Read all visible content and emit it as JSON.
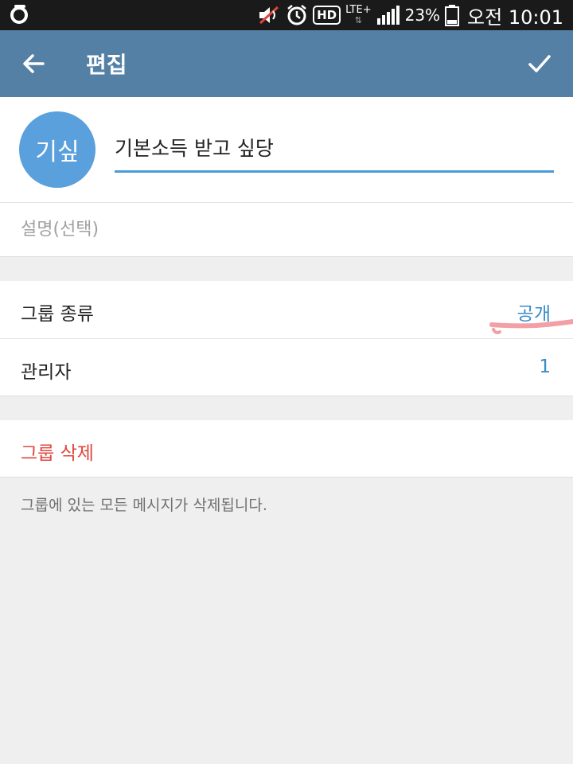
{
  "status_bar": {
    "battery": "23%",
    "time": "오전 10:01",
    "hd_label": "HD",
    "lte_label": "LTE+",
    "icons": [
      "carrier-logo-icon",
      "mute-icon",
      "alarm-icon",
      "hd-icon",
      "lte-icon",
      "signal-icon",
      "battery-icon"
    ]
  },
  "app_bar": {
    "title": "편집",
    "back_icon": "arrow-left-icon",
    "confirm_icon": "check-icon"
  },
  "group": {
    "avatar_text": "기싶",
    "avatar_color": "#5aa0dc",
    "name_value": "기본소득 받고 싶당",
    "description_placeholder": "설명(선택)"
  },
  "settings": {
    "group_type_label": "그룹 종류",
    "group_type_value": "공개",
    "admins_label": "관리자",
    "admins_value": "1"
  },
  "danger": {
    "delete_label": "그룹 삭제",
    "delete_note": "그룹에 있는 모든 메시지가 삭제됩니다."
  },
  "colors": {
    "app_bar": "#5580a6",
    "accent": "#3a8bc8",
    "danger": "#e0463d"
  }
}
